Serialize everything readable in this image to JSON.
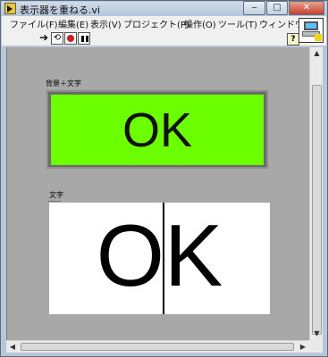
{
  "window": {
    "title": "表示器を重ねる.vi",
    "buttons": {
      "minimize": "‒",
      "maximize": "□",
      "close": "✕"
    }
  },
  "menu": [
    {
      "label": "ファイル(F)",
      "name": "menu-file"
    },
    {
      "label": "編集(E)",
      "name": "menu-edit"
    },
    {
      "label": "表示(V)",
      "name": "menu-view"
    },
    {
      "label": "プロジェクト(P)",
      "name": "menu-project"
    },
    {
      "label": "操作(O)",
      "name": "menu-operate"
    },
    {
      "label": "ツール(T)",
      "name": "menu-tools"
    },
    {
      "label": "ウィンドウ(W)",
      "name": "menu-window"
    }
  ],
  "toolbar": {
    "run_icon": "run-arrow-icon",
    "continuous_icon": "run-continuously-icon",
    "abort_icon": "abort-icon",
    "pause_icon": "pause-icon",
    "help_label": "?"
  },
  "panel": {
    "indicator1": {
      "label": "背景＋文字",
      "text": "OK",
      "background": "#6cff00"
    },
    "indicator2": {
      "label": "文字",
      "text": "OK",
      "background": "#ffffff"
    },
    "panel_background": "#a8a8a8"
  }
}
